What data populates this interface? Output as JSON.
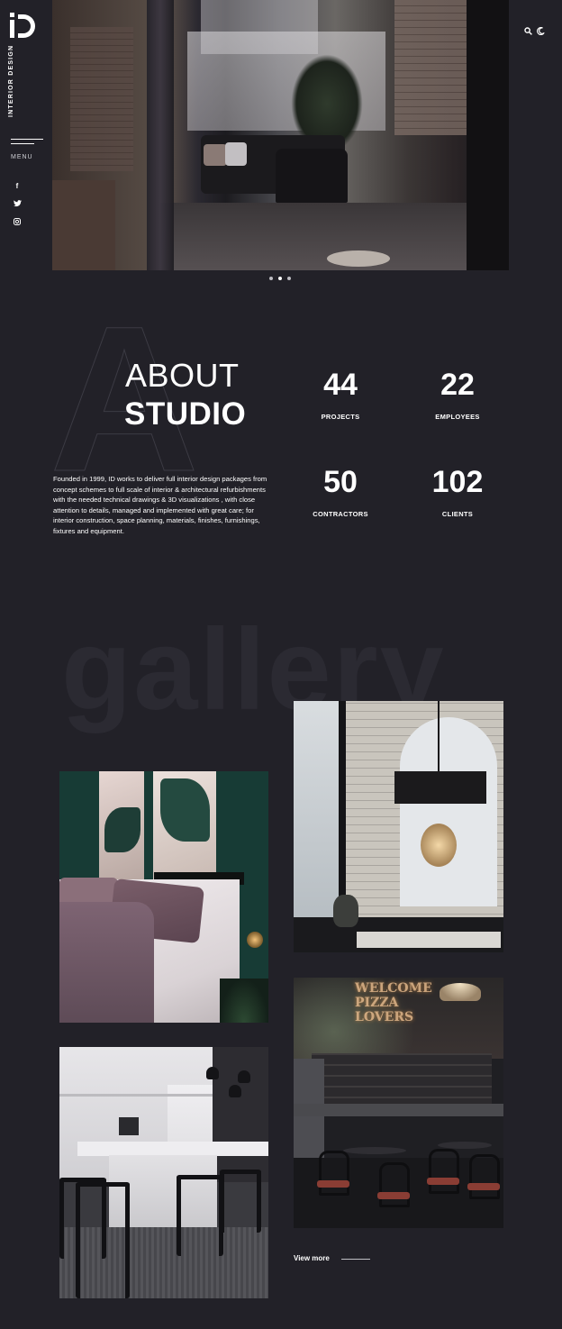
{
  "brand": {
    "logo_text": "iD",
    "vertical_title": "INTERIOR DESIGN"
  },
  "sidebar": {
    "menu_label": "MENU",
    "social": [
      {
        "name": "facebook-icon",
        "glyph": "f"
      },
      {
        "name": "twitter-icon",
        "glyph": "t"
      },
      {
        "name": "instagram-icon",
        "glyph": "◘"
      }
    ]
  },
  "top_icons": {
    "search": "search-icon",
    "theme": "moon-icon"
  },
  "hero": {
    "slides_count": 3,
    "active_slide": 2
  },
  "about": {
    "title_light": "ABOUT",
    "title_bold": "STUDIO",
    "watermark": "A",
    "description": "Founded in 1999, ID works to deliver full interior design packages from concept schemes to full scale of interior & architectural refurbishments with the needed technical drawings & 3D visualizations , with close attention to details, managed and implemented with great care; for interior construction, space planning, materials, finishes, furnishings, fixtures and equipment."
  },
  "stats": [
    {
      "value": "44",
      "label": "PROJECTS"
    },
    {
      "value": "22",
      "label": "EMPLOYEES"
    },
    {
      "value": "50",
      "label": "CONTRACTORS"
    },
    {
      "value": "102",
      "label": "CLIENTS"
    }
  ],
  "gallery": {
    "watermark": "gallery",
    "bar_neon_text": "WELCOME PIZZA LOVERS",
    "view_more": "View more"
  },
  "colors": {
    "background": "#222128",
    "text": "#ffffff",
    "watermark": "#2b2a32"
  }
}
